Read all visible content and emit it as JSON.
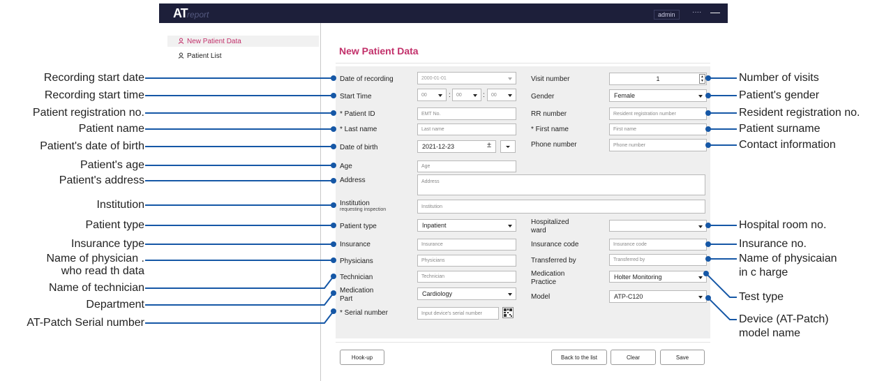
{
  "app": {
    "logo_mark": "AT",
    "logo_text": "report",
    "user": "admin",
    "more": "····",
    "minimize": "—"
  },
  "sidebar": {
    "items": [
      {
        "label": "New Patient Data",
        "active": true
      },
      {
        "label": "Patient List",
        "active": false
      }
    ]
  },
  "form": {
    "title": "New Patient Data",
    "date_of_recording": {
      "label": "Date of recording",
      "value": "2000-01-01"
    },
    "start_time": {
      "label": "Start Time",
      "hour": "00",
      "minute": "00",
      "second": "00",
      "sep": ":"
    },
    "patient_id": {
      "label": "* Patient ID",
      "placeholder": "EMT No."
    },
    "last_name": {
      "label": "* Last name",
      "placeholder": "Last name"
    },
    "date_of_birth": {
      "label": "Date of birth",
      "value": "2021-12-23"
    },
    "age": {
      "label": "Age",
      "placeholder": "Age"
    },
    "address": {
      "label": "Address",
      "placeholder": "Address"
    },
    "institution": {
      "label": "Institution",
      "sublabel": "requesting inspection",
      "placeholder": "Institution"
    },
    "patient_type": {
      "label": "Patient type",
      "value": "Inpatient"
    },
    "insurance": {
      "label": "Insurance",
      "placeholder": "Insurance"
    },
    "physicians": {
      "label": "Physicians",
      "placeholder": "Physicians"
    },
    "technician": {
      "label": "Technician",
      "placeholder": "Technician"
    },
    "medication_part": {
      "label_1": "Medication",
      "label_2": "Part",
      "value": "Cardiology"
    },
    "serial_number": {
      "label": "* Serial number",
      "placeholder": "Input device's serial number"
    },
    "visit_number": {
      "label": "Visit number",
      "value": "1"
    },
    "gender": {
      "label": "Gender",
      "value": "Female"
    },
    "rr_number": {
      "label": "RR number",
      "placeholder": "Resident registration number"
    },
    "first_name": {
      "label": "* First name",
      "placeholder": "First name"
    },
    "phone_number": {
      "label": "Phone number",
      "placeholder": "Phone number"
    },
    "hospitalized_ward": {
      "label_1": "Hospitalized",
      "label_2": "ward",
      "value": ""
    },
    "insurance_code": {
      "label": "Insurance code",
      "placeholder": "Insurance code"
    },
    "transferred_by": {
      "label": "Transferred by",
      "placeholder": "Transferred by"
    },
    "medication_practice": {
      "label_1": "Medication",
      "label_2": "Practice",
      "value": "Holter Monitoring"
    },
    "model": {
      "label": "Model",
      "value": "ATP-C120"
    }
  },
  "buttons": {
    "hookup": "Hook-up",
    "back": "Back to the list",
    "clear": "Clear",
    "save": "Save"
  },
  "annotations": {
    "left": [
      "Recording start date",
      "Recording start time",
      "Patient registration no.",
      "Patient name",
      "Patient's date of birth",
      "Patient's age",
      "Patient's address",
      "Institution",
      "Patient type",
      "Insurance type",
      "Name of physician .",
      "who read th data",
      "Name of technician",
      "Department",
      "AT-Patch Serial number"
    ],
    "right": [
      "Number of visits",
      "Patient's gender",
      "Resident registration no.",
      "Patient surname",
      "Contact information",
      "Hospital room no.",
      "Insurance no.",
      "Name of physicaian",
      "in c harge",
      "Test type",
      "Device (AT-Patch)",
      "model name"
    ]
  },
  "colors": {
    "accent": "#c2306a",
    "callout": "#1557a6",
    "topbar": "#1d1f3a"
  }
}
